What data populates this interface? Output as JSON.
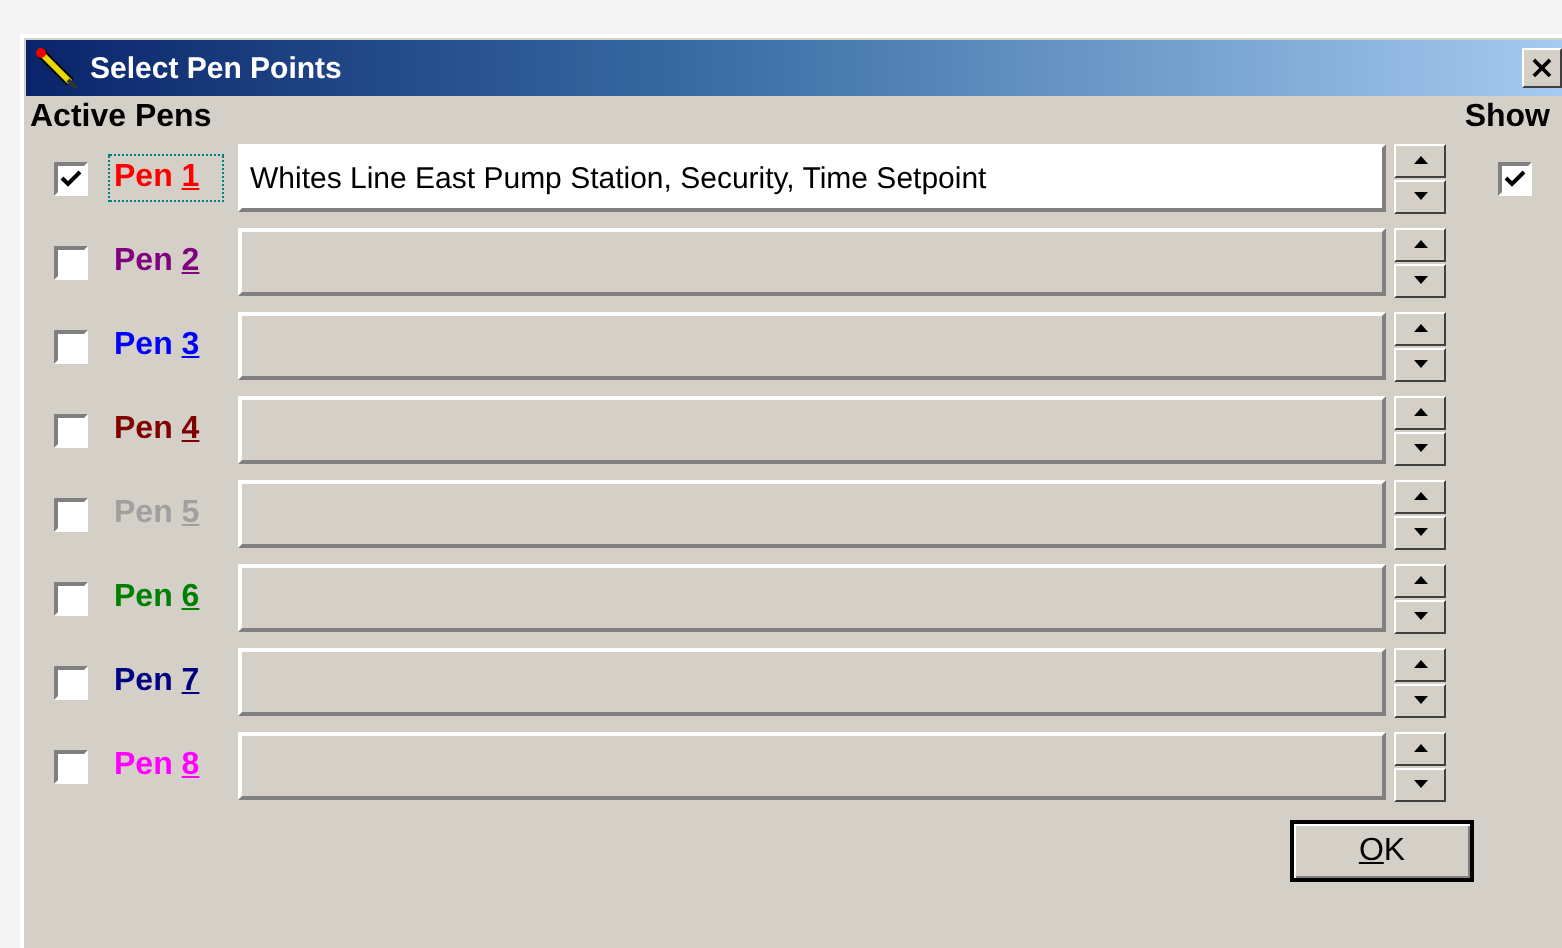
{
  "window": {
    "title": "Select Pen Points",
    "close": "×"
  },
  "headers": {
    "pens": "Active Pens",
    "show": "Show"
  },
  "pens": [
    {
      "label": "Pen",
      "mnemonic": "1",
      "color": "#ff0000",
      "checked": true,
      "focused": true,
      "value": "Whites Line East Pump Station, Security, Time Setpoint",
      "show": true
    },
    {
      "label": "Pen",
      "mnemonic": "2",
      "color": "#800080",
      "checked": false,
      "focused": false
    },
    {
      "label": "Pen",
      "mnemonic": "3",
      "color": "#0000ff",
      "checked": false,
      "focused": false
    },
    {
      "label": "Pen",
      "mnemonic": "4",
      "color": "#800000",
      "checked": false,
      "focused": false
    },
    {
      "label": "Pen",
      "mnemonic": "5",
      "color": "#a0a0a0",
      "checked": false,
      "focused": false
    },
    {
      "label": "Pen",
      "mnemonic": "6",
      "color": "#008000",
      "checked": false,
      "focused": false
    },
    {
      "label": "Pen",
      "mnemonic": "7",
      "color": "#000080",
      "checked": false,
      "focused": false
    },
    {
      "label": "Pen",
      "mnemonic": "8",
      "color": "#ff00ff",
      "checked": false,
      "focused": false
    }
  ],
  "ok": {
    "mnemonic": "O",
    "rest": "K"
  }
}
